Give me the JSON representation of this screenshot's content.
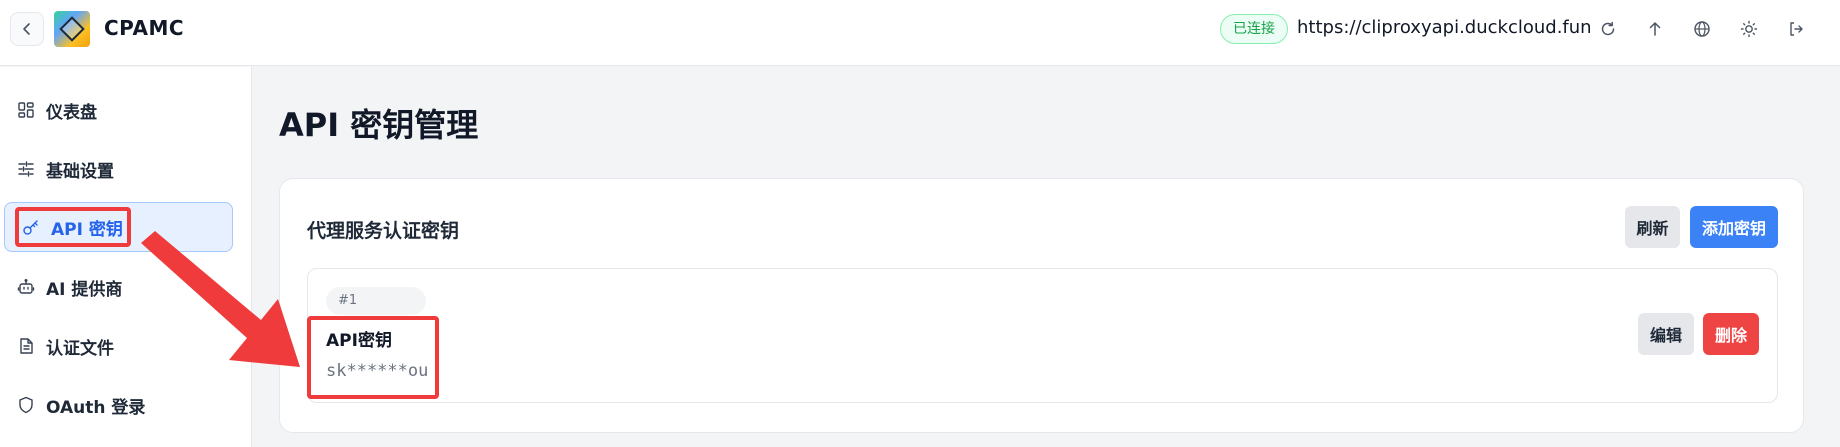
{
  "header": {
    "app_title": "CPAMC",
    "status": "已连接",
    "server_url": "https://cliproxyapi.duckcloud.fun",
    "icons": [
      "chevron-left-icon",
      "logo",
      "refresh-icon",
      "arrow-up-icon",
      "globe-icon",
      "sun-icon",
      "logout-icon"
    ]
  },
  "sidebar": {
    "items": [
      {
        "label": "仪表盘",
        "icon": "dashboard-icon"
      },
      {
        "label": "基础设置",
        "icon": "sliders-icon"
      },
      {
        "label": "API 密钥",
        "icon": "key-icon",
        "active": true
      },
      {
        "label": "AI 提供商",
        "icon": "bot-icon"
      },
      {
        "label": "认证文件",
        "icon": "file-icon"
      },
      {
        "label": "OAuth 登录",
        "icon": "shield-icon"
      }
    ]
  },
  "main": {
    "page_title": "API 密钥管理",
    "card": {
      "title": "代理服务认证密钥",
      "refresh_label": "刷新",
      "add_label": "添加密钥",
      "keys": [
        {
          "index": "#1",
          "name": "API密钥",
          "value": "sk******ou",
          "edit_label": "编辑",
          "delete_label": "删除"
        }
      ]
    }
  },
  "colors": {
    "accent": "#3b82f6",
    "danger": "#ef4444",
    "status_green": "#16a34a",
    "annotation_red": "#ef3b3b"
  }
}
